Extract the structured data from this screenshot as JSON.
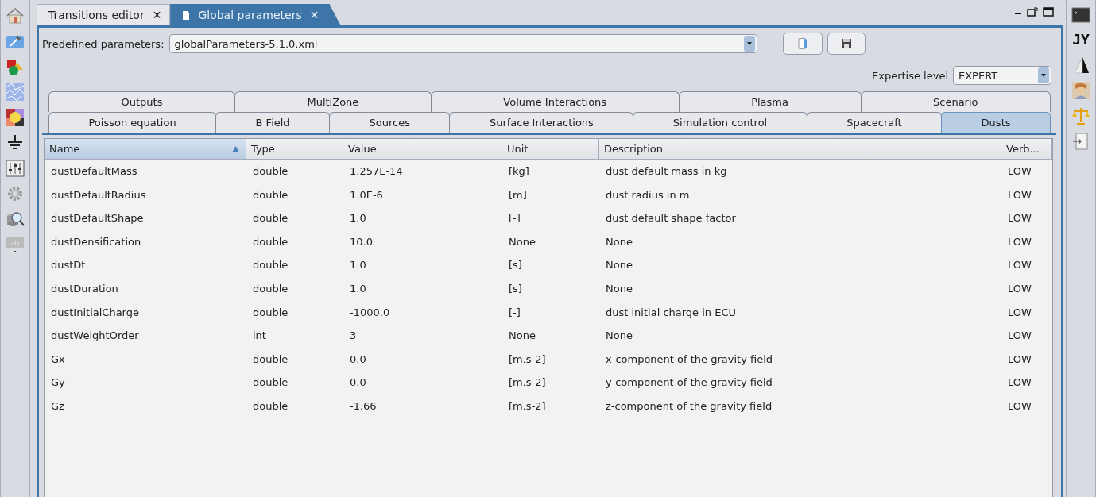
{
  "editor_tabs": [
    {
      "label": "Transitions editor",
      "close": "✕",
      "selected": false
    },
    {
      "label": "Global parameters",
      "close": "✕",
      "selected": true
    }
  ],
  "right_toolbar": {
    "jython_label": "JY"
  },
  "predefined": {
    "label": "Predefined parameters:",
    "value": "globalParameters-5.1.0.xml"
  },
  "expertise": {
    "label": "Expertise level",
    "value": "EXPERT"
  },
  "param_tab_rows": [
    [
      {
        "label": "Outputs",
        "selected": false
      },
      {
        "label": "MultiZone",
        "selected": false
      },
      {
        "label": "Volume Interactions",
        "selected": false
      },
      {
        "label": "Plasma",
        "selected": false
      },
      {
        "label": "Scenario",
        "selected": false
      }
    ],
    [
      {
        "label": "Poisson equation",
        "selected": false
      },
      {
        "label": "B Field",
        "selected": false
      },
      {
        "label": "Sources",
        "selected": false
      },
      {
        "label": "Surface Interactions",
        "selected": false
      },
      {
        "label": "Simulation control",
        "selected": false
      },
      {
        "label": "Spacecraft",
        "selected": false
      },
      {
        "label": "Dusts",
        "selected": true
      }
    ]
  ],
  "table": {
    "columns": [
      {
        "label": "Name",
        "sorted": true
      },
      {
        "label": "Type",
        "sorted": false
      },
      {
        "label": "Value",
        "sorted": false
      },
      {
        "label": "Unit",
        "sorted": false
      },
      {
        "label": "Description",
        "sorted": false
      },
      {
        "label": "Verb...",
        "sorted": false
      }
    ],
    "rows": [
      [
        "dustDefaultMass",
        "double",
        "1.257E-14",
        "[kg]",
        "dust default mass in kg",
        "LOW"
      ],
      [
        "dustDefaultRadius",
        "double",
        "1.0E-6",
        "[m]",
        "dust radius in m",
        "LOW"
      ],
      [
        "dustDefaultShape",
        "double",
        "1.0",
        "[-]",
        "dust default shape factor",
        "LOW"
      ],
      [
        "dustDensification",
        "double",
        "10.0",
        "None",
        "None",
        "LOW"
      ],
      [
        "dustDt",
        "double",
        "1.0",
        "[s]",
        "None",
        "LOW"
      ],
      [
        "dustDuration",
        "double",
        "1.0",
        "[s]",
        "None",
        "LOW"
      ],
      [
        "dustInitialCharge",
        "double",
        "-1000.0",
        "[-]",
        "dust initial charge in ECU",
        "LOW"
      ],
      [
        "dustWeightOrder",
        "int",
        "3",
        "None",
        "None",
        "LOW"
      ],
      [
        "Gx",
        "double",
        "0.0",
        "[m.s-2]",
        "x-component of the gravity field",
        "LOW"
      ],
      [
        "Gy",
        "double",
        "0.0",
        "[m.s-2]",
        "y-component of the gravity field",
        "LOW"
      ],
      [
        "Gz",
        "double",
        "-1.66",
        "[m.s-2]",
        "z-component of the gravity field",
        "LOW"
      ]
    ]
  }
}
